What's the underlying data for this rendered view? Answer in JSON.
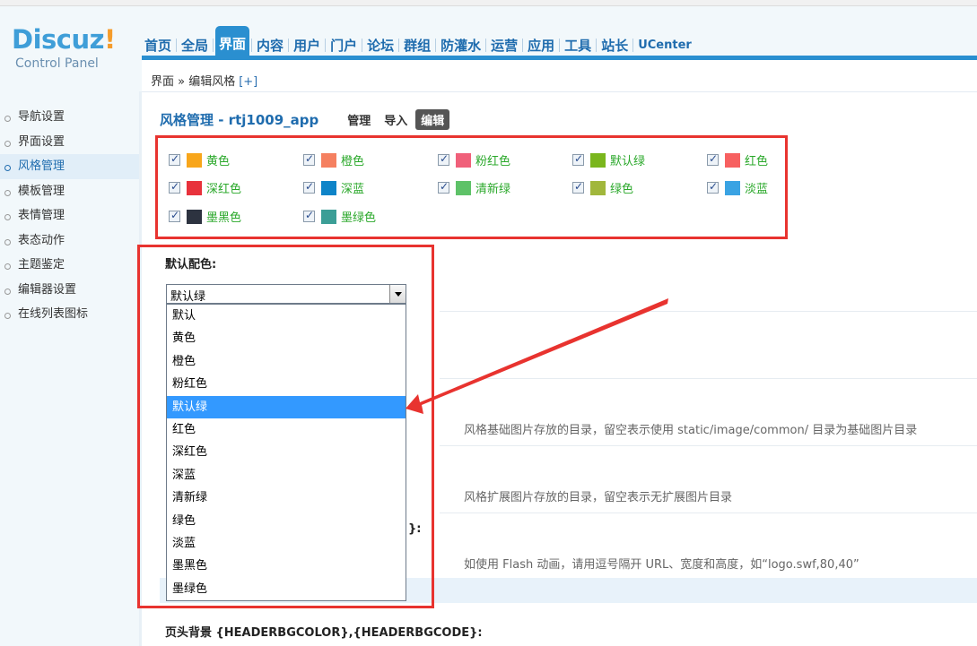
{
  "header": {
    "logo_text": "Discuz",
    "logo_bang": "!",
    "logo_sub": "Control Panel",
    "nav": [
      "首页",
      "全局",
      "界面",
      "内容",
      "用户",
      "门户",
      "论坛",
      "群组",
      "防灌水",
      "运营",
      "应用",
      "工具",
      "站长",
      "UCenter"
    ],
    "active_nav": "界面"
  },
  "breadcrumb": {
    "text": "界面 » 编辑风格",
    "plus": "[+]"
  },
  "sidebar": {
    "items": [
      "导航设置",
      "界面设置",
      "风格管理",
      "模板管理",
      "表情管理",
      "表态动作",
      "主题鉴定",
      "编辑器设置",
      "在线列表图标"
    ],
    "active": "风格管理"
  },
  "page": {
    "title": "风格管理 - rtj1009_app",
    "tabs": [
      "管理",
      "导入",
      "编辑"
    ],
    "active_tab": "编辑"
  },
  "colors": [
    {
      "label": "黄色",
      "swatch": "#f8a61b"
    },
    {
      "label": "橙色",
      "swatch": "#f58060"
    },
    {
      "label": "粉红色",
      "swatch": "#f0607a"
    },
    {
      "label": "默认绿",
      "swatch": "#7ab61d"
    },
    {
      "label": "红色",
      "swatch": "#f76060"
    },
    {
      "label": "深红色",
      "swatch": "#e8323c"
    },
    {
      "label": "深蓝",
      "swatch": "#0e84c8"
    },
    {
      "label": "清新绿",
      "swatch": "#5ec268"
    },
    {
      "label": "绿色",
      "swatch": "#a1b73c"
    },
    {
      "label": "淡蓝",
      "swatch": "#3aa3e3"
    },
    {
      "label": "墨黑色",
      "swatch": "#2d3340"
    },
    {
      "label": "墨绿色",
      "swatch": "#3b9e96"
    }
  ],
  "default_color": {
    "label": "默认配色:",
    "selected": "默认绿",
    "options": [
      "默认",
      "黄色",
      "橙色",
      "粉红色",
      "默认绿",
      "红色",
      "深红色",
      "深蓝",
      "清新绿",
      "绿色",
      "淡蓝",
      "墨黑色",
      "墨绿色"
    ]
  },
  "hints": {
    "image_dir": "风格基础图片存放的目录，留空表示使用 static/image/common/ 目录为基础图片目录",
    "ext_dir": "风格扩展图片存放的目录，留空表示无扩展图片目录",
    "logo": "如使用 Flash 动画，请用逗号隔开 URL、宽度和高度，如“logo.swf,80,40”",
    "partial_label": "}:"
  },
  "header_bg": {
    "label": "页头背景 {HEADERBGCOLOR},{HEADERBGCODE}:"
  }
}
